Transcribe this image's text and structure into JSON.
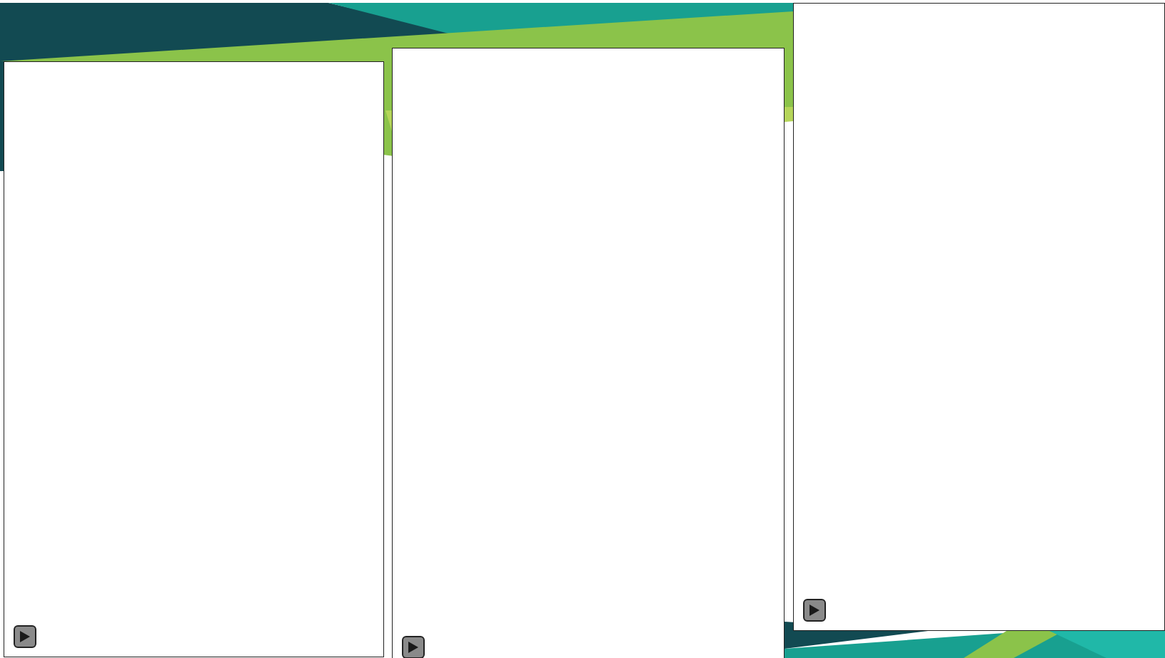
{
  "panels": [
    {
      "kind": "player"
    },
    {
      "kind": "player"
    },
    {
      "kind": "player"
    }
  ]
}
